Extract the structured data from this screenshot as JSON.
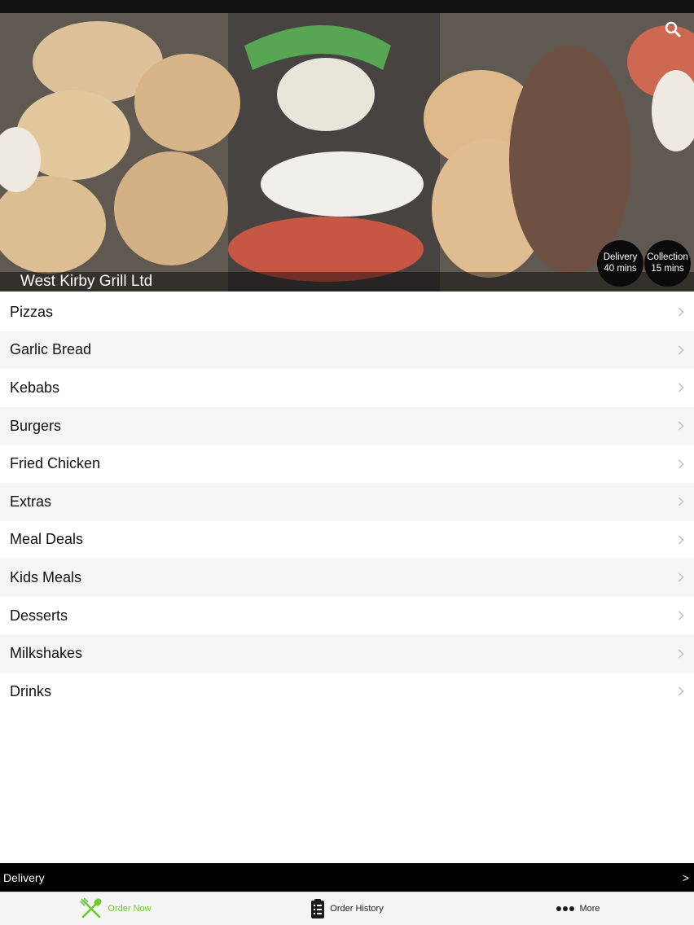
{
  "header": {
    "restaurant_name": "West Kirby Grill Ltd",
    "search_icon": "search-icon",
    "delivery_badge": {
      "title": "Delivery",
      "time": "40 mins"
    },
    "collection_badge": {
      "title": "Collection",
      "time": "15 mins"
    }
  },
  "menu": {
    "items": [
      {
        "label": "Pizzas"
      },
      {
        "label": "Garlic Bread"
      },
      {
        "label": "Kebabs"
      },
      {
        "label": "Burgers"
      },
      {
        "label": "Fried Chicken"
      },
      {
        "label": "Extras"
      },
      {
        "label": "Meal Deals"
      },
      {
        "label": "Kids Meals"
      },
      {
        "label": "Desserts"
      },
      {
        "label": "Milkshakes"
      },
      {
        "label": "Drinks"
      }
    ],
    "chevron_icon": "chevron-right-icon"
  },
  "order_bar": {
    "mode": "Delivery",
    "arrow": ">"
  },
  "tabs": [
    {
      "label": "Order Now",
      "icon": "fork-knife-icon",
      "active": true
    },
    {
      "label": "Order History",
      "icon": "clipboard-icon",
      "active": false
    },
    {
      "label": "More",
      "icon": "more-dots-icon",
      "active": false
    }
  ],
  "colors": {
    "accent": "#6ccc2a",
    "order_bar": "#000000",
    "tab_bar": "#f4f4f4"
  }
}
